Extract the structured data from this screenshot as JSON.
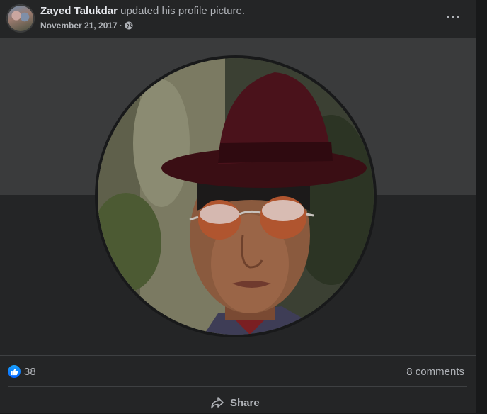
{
  "post": {
    "author_name": "Zayed Talukdar",
    "action_text": " updated his profile picture.",
    "date": "November 21, 2017",
    "separator": "·",
    "privacy_icon": "globe-icon",
    "more_icon": "more-options-icon"
  },
  "reactions": {
    "like_count": "38",
    "comments_label": "8 comments"
  },
  "actions": {
    "share_label": "Share"
  },
  "colors": {
    "card_bg": "#242526",
    "cover_bg": "#3a3b3c",
    "like_blue": "#0866ff",
    "text_secondary": "#b0b3b8"
  }
}
